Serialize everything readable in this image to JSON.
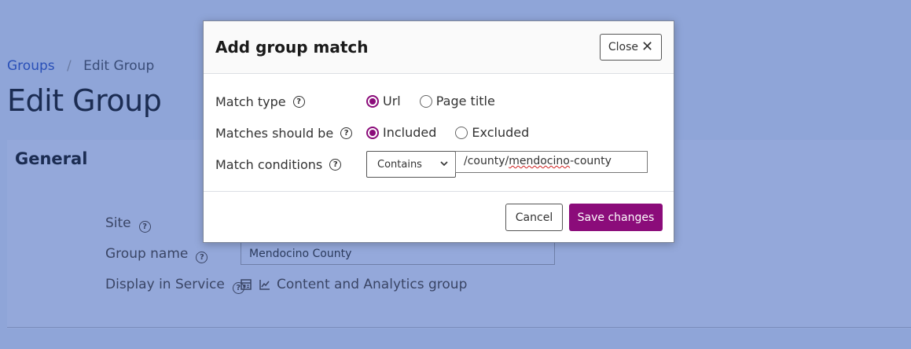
{
  "background": {
    "breadcrumb": {
      "link": "Groups",
      "separator": "/",
      "current": "Edit Group"
    },
    "page_title": "Edit Group",
    "panel": {
      "heading": "General",
      "site_label": "Site",
      "group_name_label": "Group name",
      "group_name_value": "Mendocino County",
      "display_label": "Display in Service",
      "display_value": "Content and Analytics group"
    }
  },
  "modal": {
    "title": "Add group match",
    "close_label": "Close",
    "close_glyph": "✕",
    "match_type": {
      "label": "Match type",
      "options": [
        "Url",
        "Page title"
      ],
      "selected": "Url"
    },
    "matches_should_be": {
      "label": "Matches should be",
      "options": [
        "Included",
        "Excluded"
      ],
      "selected": "Included"
    },
    "match_conditions": {
      "label": "Match conditions",
      "operator": "Contains",
      "value_prefix": "/county/",
      "value_misspelled": "mendocino",
      "value_suffix": "-county"
    },
    "cancel_label": "Cancel",
    "save_label": "Save changes"
  },
  "colors": {
    "overlay_bg": "#8fa5d8",
    "accent": "#8b0c7a",
    "link": "#2a50b8"
  }
}
